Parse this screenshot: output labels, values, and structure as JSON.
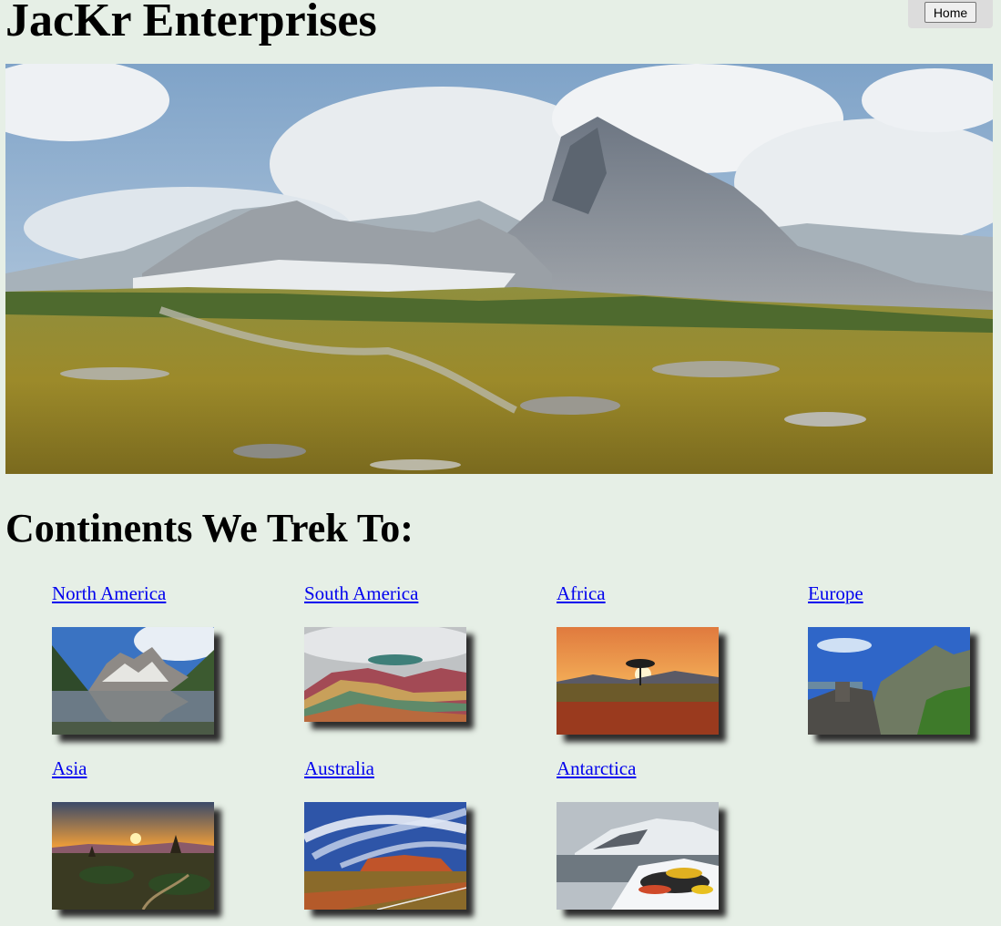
{
  "header": {
    "site_title": "JacKr Enterprises",
    "home_button": "Home"
  },
  "hero": {
    "image": "mountain-landscape-image"
  },
  "continents": {
    "heading": "Continents We Trek To:",
    "items": [
      {
        "name": "North America",
        "image": "mountain-lake-image"
      },
      {
        "name": "South America",
        "image": "rainbow-mountain-image"
      },
      {
        "name": "Africa",
        "image": "savanna-sunset-image"
      },
      {
        "name": "Europe",
        "image": "alpine-ruins-image"
      },
      {
        "name": "Asia",
        "image": "temple-sunset-image"
      },
      {
        "name": "Australia",
        "image": "uluru-image"
      },
      {
        "name": "Antarctica",
        "image": "antarctic-expedition-image"
      }
    ]
  }
}
